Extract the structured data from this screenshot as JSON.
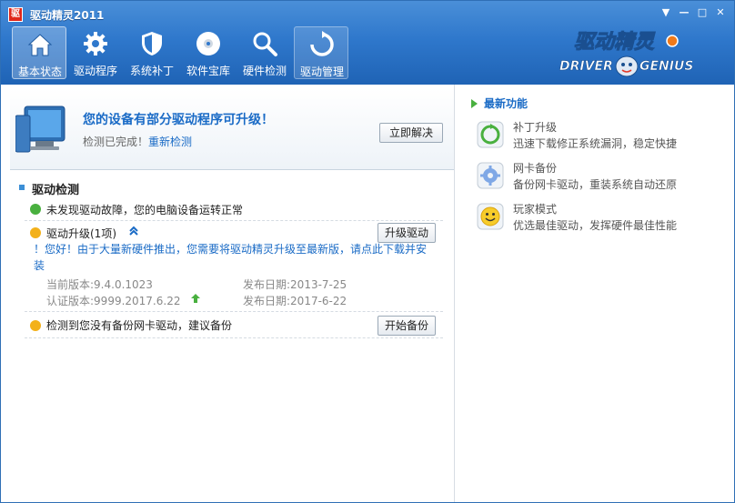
{
  "window": {
    "title": "驱动精灵2011",
    "logo_char": "驱",
    "controls": [
      "▼",
      "—",
      "□",
      "✕"
    ]
  },
  "toolbar": {
    "items": [
      {
        "label": "基本状态",
        "icon": "home-icon",
        "active": true
      },
      {
        "label": "驱动程序",
        "icon": "gear-icon",
        "active": false
      },
      {
        "label": "系统补丁",
        "icon": "shield-icon",
        "active": false
      },
      {
        "label": "软件宝库",
        "icon": "disc-icon",
        "active": false
      },
      {
        "label": "硬件检测",
        "icon": "magnifier-icon",
        "active": false
      },
      {
        "label": "驱动管理",
        "icon": "refresh-icon",
        "active": false
      }
    ]
  },
  "brand": {
    "cn": "驱动精灵",
    "en": "DRIVER GENIUS"
  },
  "banner": {
    "title": "您的设备有部分驱动程序可升级！",
    "status": "检测已完成！",
    "recheck_link": "重新检测",
    "fix_button": "立即解决"
  },
  "detection": {
    "section_title": "驱动检测",
    "ok_message": "未发现驱动故障，您的电脑设备运转正常",
    "upgrade_title": "驱动升级(1项)",
    "upgrade_button": "升级驱动",
    "notice": "！您好！由于大量新硬件推出，您需要将驱动精灵升级至最新版，请点此下载并安装",
    "current_version_label": "当前版本:9.4.0.1023",
    "current_date_label": "发布日期:2013-7-25",
    "cert_version_label": "认证版本:9999.2017.6.22",
    "cert_date_label": "发布日期:2017-6-22",
    "backup_message": "检测到您没有备份网卡驱动，建议备份",
    "backup_button": "开始备份"
  },
  "news": {
    "title": "最新功能",
    "features": [
      {
        "name": "补丁升级",
        "desc": "迅速下载修正系统漏洞，稳定快捷",
        "icon": "patch-icon"
      },
      {
        "name": "网卡备份",
        "desc": "备份网卡驱动，重装系统自动还原",
        "icon": "network-gear-icon"
      },
      {
        "name": "玩家模式",
        "desc": "优选最佳驱动，发挥硬件最佳性能",
        "icon": "smiley-icon"
      }
    ]
  },
  "colors": {
    "header_blue": "#2f78cc",
    "link_blue": "#1a6bc6",
    "ok_green": "#49b03f",
    "warn_yellow": "#f3b11a"
  }
}
